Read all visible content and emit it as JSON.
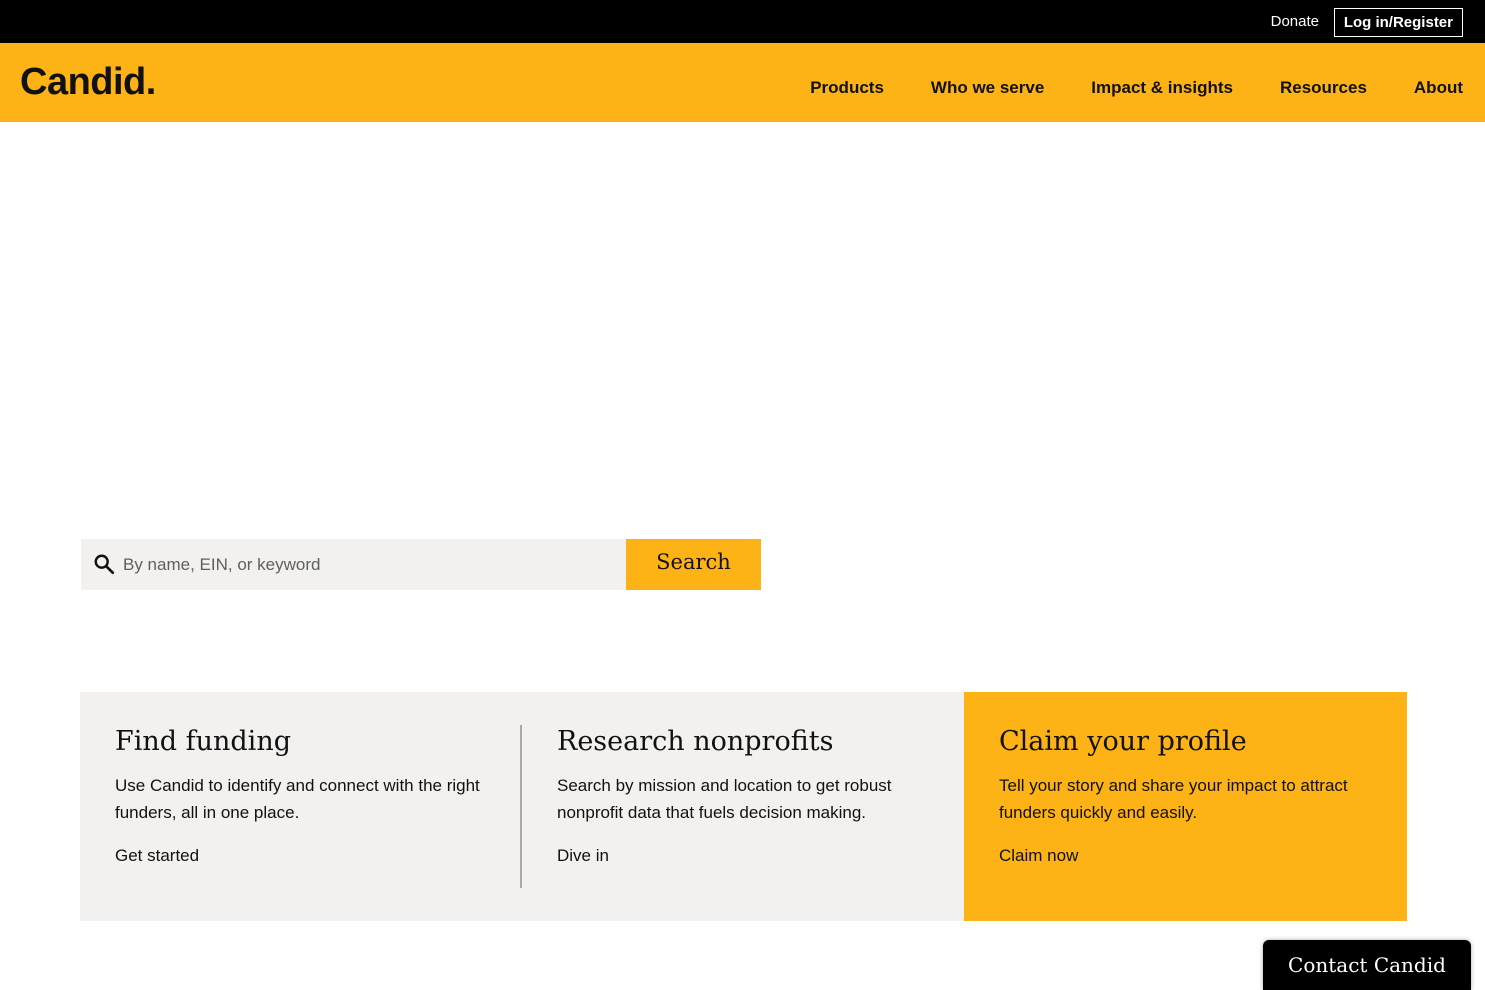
{
  "topbar": {
    "donate_label": "Donate",
    "login_label": "Log in/Register"
  },
  "header": {
    "logo_text": "Candid.",
    "nav": [
      {
        "label": "Products"
      },
      {
        "label": "Who we serve"
      },
      {
        "label": "Impact & insights"
      },
      {
        "label": "Resources"
      },
      {
        "label": "About"
      }
    ]
  },
  "search": {
    "placeholder": "By name, EIN, or keyword",
    "value": "",
    "button_label": "Search",
    "icon": "search-icon"
  },
  "cards": [
    {
      "title": "Find funding",
      "description": "Use Candid to identify and connect with the right funders, all in one place.",
      "link_label": "Get started"
    },
    {
      "title": "Research nonprofits",
      "description": "Search by mission and location to get robust nonprofit data that fuels decision making.",
      "link_label": "Dive in"
    },
    {
      "title": "Claim your profile",
      "description": "Tell your story and share your impact to attract funders quickly and easily.",
      "link_label": "Claim now"
    }
  ],
  "contact": {
    "label": "Contact Candid"
  },
  "colors": {
    "brand_yellow": "#FDB315",
    "topbar_black": "#000000",
    "card_gray": "#F2F1EF"
  }
}
